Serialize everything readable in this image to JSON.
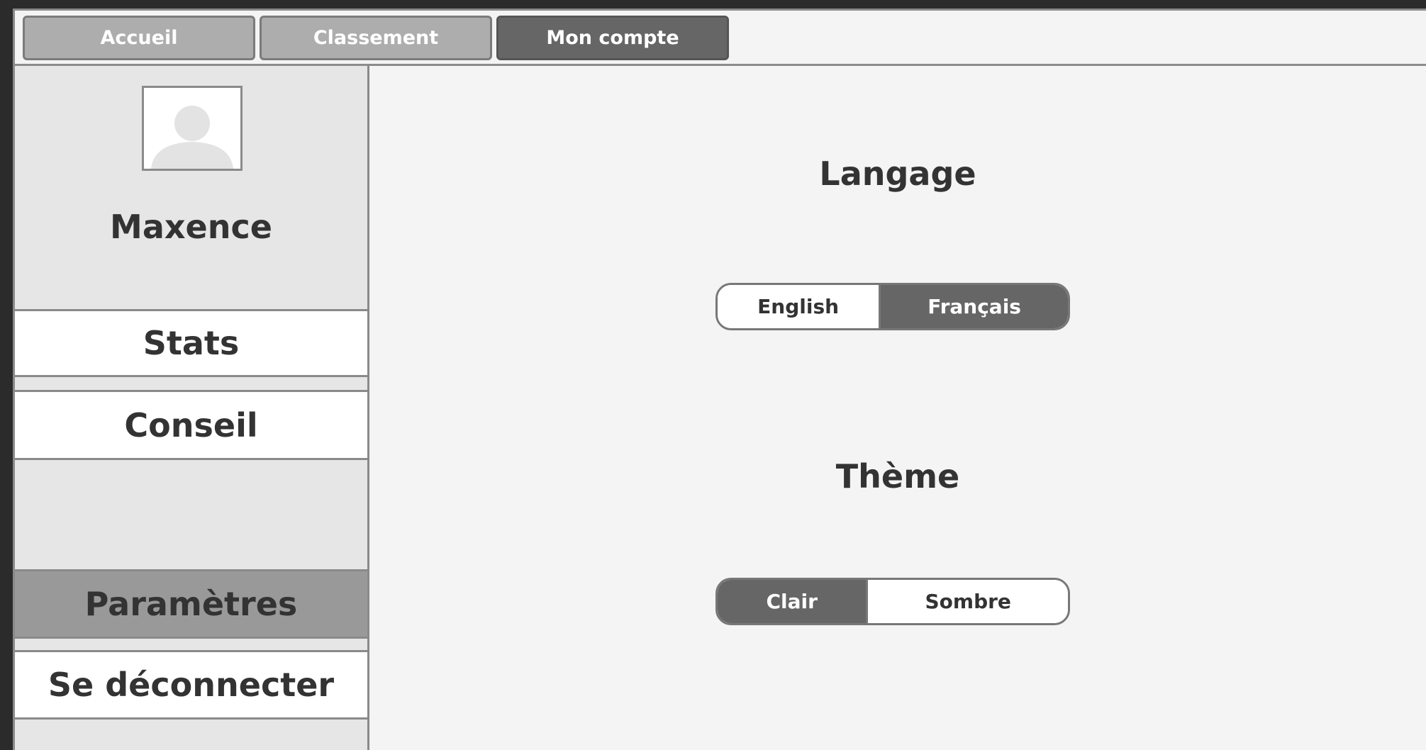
{
  "tabs": [
    {
      "label": "Accueil",
      "active": false
    },
    {
      "label": "Classement",
      "active": false
    },
    {
      "label": "Mon compte",
      "active": true
    }
  ],
  "profile": {
    "name": "Maxence"
  },
  "sidebar": {
    "items": [
      {
        "label": "Stats"
      },
      {
        "label": "Conseil"
      },
      {
        "label": "Paramètres",
        "active": true
      },
      {
        "label": "Se déconnecter"
      }
    ]
  },
  "settings": {
    "language": {
      "title": "Langage",
      "options": [
        {
          "label": "English",
          "selected": false
        },
        {
          "label": "Français",
          "selected": true
        }
      ]
    },
    "theme": {
      "title": "Thème",
      "options": [
        {
          "label": "Clair",
          "selected": true
        },
        {
          "label": "Sombre",
          "selected": false
        }
      ]
    }
  },
  "colors": {
    "selected": "#666666",
    "tab_inactive": "#adadad",
    "sidebar_active": "#999999",
    "background": "#f4f4f4"
  }
}
